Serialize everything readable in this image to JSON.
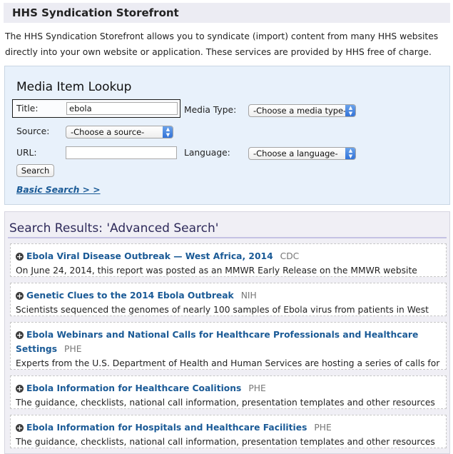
{
  "header": {
    "title": "HHS Syndication Storefront"
  },
  "intro": "The HHS Syndication Storefront allows you to syndicate (import) content from many HHS websites directly into your own website or application. These services are provided by HHS free of charge.",
  "lookup": {
    "title": "Media Item Lookup",
    "title_label": "Title:",
    "title_value": "ebola",
    "media_type_label": "Media Type:",
    "media_type_value": "-Choose a media type-",
    "source_label": "Source:",
    "source_value": "-Choose a source-",
    "url_label": "URL:",
    "url_value": "",
    "language_label": "Language:",
    "language_value": "-Choose a language-",
    "search_button": "Search",
    "basic_search_link": "Basic Search > >"
  },
  "results": {
    "heading": "Search Results: 'Advanced Search'",
    "items": [
      {
        "title": "Ebola Viral Disease Outbreak — West Africa, 2014",
        "source": "CDC",
        "description": "On June 24, 2014, this report was posted as an MMWR Early Release on the MMWR website"
      },
      {
        "title": "Genetic Clues to the 2014 Ebola Outbreak",
        "source": "NIH",
        "description": "Scientists sequenced the genomes of nearly 100 samples of Ebola virus from patients in West"
      },
      {
        "title": "Ebola Webinars and National Calls for Healthcare Professionals and Healthcare Settings",
        "source": "PHE",
        "description": "Experts from the U.S. Department of Health and Human Services are hosting a series of calls for"
      },
      {
        "title": "Ebola Information for Healthcare Coalitions",
        "source": "PHE",
        "description": "The guidance, checklists, national call information, presentation templates and other resources"
      },
      {
        "title": "Ebola Information for Hospitals and Healthcare Facilities",
        "source": "PHE",
        "description": "The guidance, checklists, national call information, presentation templates and other resources"
      }
    ]
  }
}
